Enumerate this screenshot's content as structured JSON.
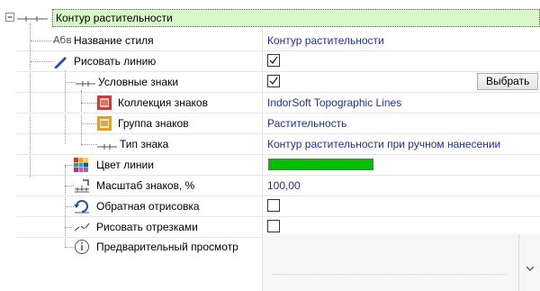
{
  "root": {
    "label": "Контур растительности",
    "highlight": "#d9f8c8"
  },
  "rows": [
    {
      "label": "Название стиля",
      "value": "Контур растительности"
    },
    {
      "label": "Рисовать линию",
      "checked": true
    },
    {
      "label": "Условные знаки",
      "checked": true,
      "button": "Выбрать"
    },
    {
      "label": "Коллекция знаков",
      "value": "IndorSoft Topographic Lines"
    },
    {
      "label": "Группа знаков",
      "value": "Растительность"
    },
    {
      "label": "Тип знака",
      "value": "Контур растительности при ручном нанесении"
    },
    {
      "label": "Цвет линии",
      "color": "#00c000"
    },
    {
      "label": "Масштаб знаков, %",
      "value": "100,00"
    },
    {
      "label": "Обратная отрисовка",
      "checked": false
    },
    {
      "label": "Рисовать отрезками",
      "checked": false
    },
    {
      "label": "Предварительный просмотр"
    }
  ],
  "abv_icon_text": "Абв",
  "colors": {
    "value_text": "#1a2fb0",
    "swatch": "#00c000"
  }
}
